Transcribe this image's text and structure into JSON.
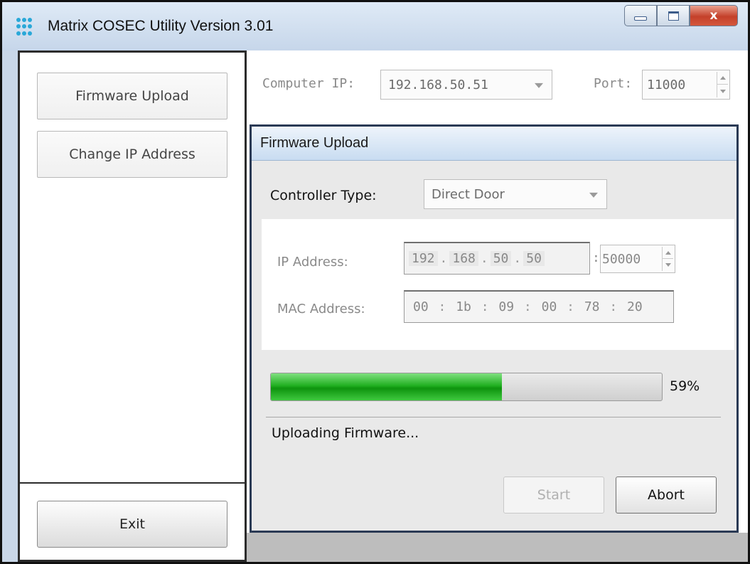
{
  "window": {
    "title": "Matrix COSEC Utility Version 3.01",
    "close_glyph": "x"
  },
  "sidebar": {
    "items": [
      {
        "label": "Firmware Upload"
      },
      {
        "label": "Change IP Address"
      }
    ],
    "exit_label": "Exit"
  },
  "connection": {
    "computer_ip_label": "Computer IP:",
    "computer_ip_value": "192.168.50.51",
    "port_label": "Port:",
    "port_value": "11000"
  },
  "panel": {
    "title": "Firmware Upload",
    "controller_type_label": "Controller Type:",
    "controller_type_value": "Direct Door",
    "ip_label": "IP Address:",
    "ip_octets": [
      "192",
      "168",
      "50",
      "50"
    ],
    "ip_port": "50000",
    "mac_label": "MAC Address:",
    "mac_parts": [
      "00",
      "1b",
      "09",
      "00",
      "78",
      "20"
    ],
    "progress_percent": 59,
    "progress_text": "59%",
    "status_text": "Uploading Firmware...",
    "start_label": "Start",
    "abort_label": "Abort"
  }
}
